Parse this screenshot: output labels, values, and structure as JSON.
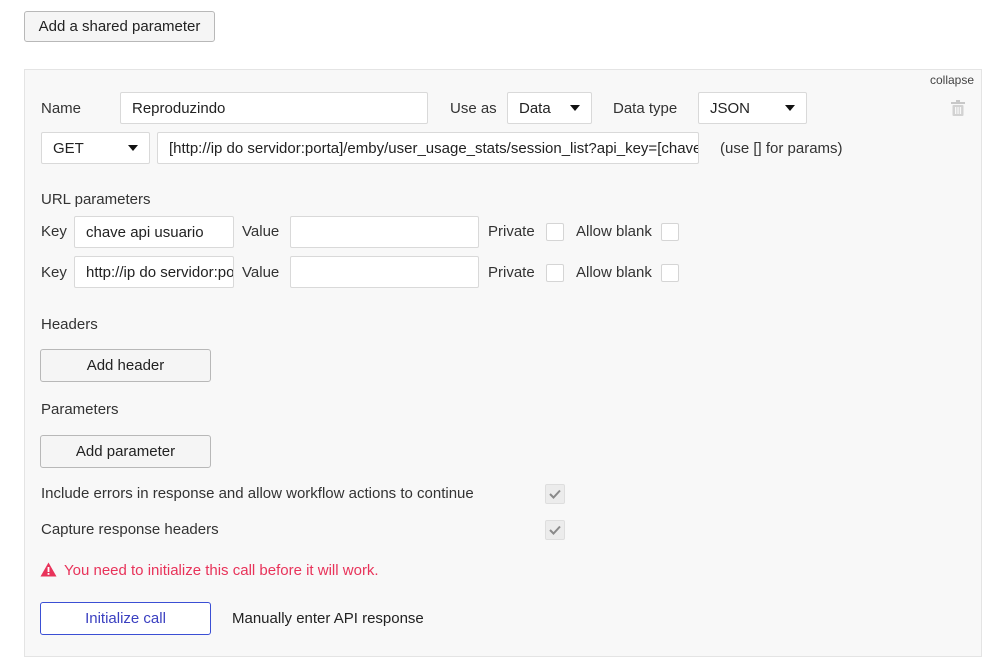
{
  "top": {
    "add_shared_label": "Add a shared parameter"
  },
  "panel": {
    "collapse_label": "collapse",
    "name_label": "Name",
    "name_value": "Reproduzindo",
    "use_as_label": "Use as",
    "use_as_value": "Data",
    "data_type_label": "Data type",
    "data_type_value": "JSON",
    "method_value": "GET",
    "url_value": "[http://ip do servidor:porta]/emby/user_usage_stats/session_list?api_key=[chave api usuario]",
    "url_hint": "(use [] for params)",
    "url_params_title": "URL parameters",
    "url_params": [
      {
        "key_label": "Key",
        "key_value": "chave api usuario",
        "value_label": "Value",
        "value_value": "",
        "private_label": "Private",
        "allow_blank_label": "Allow blank"
      },
      {
        "key_label": "Key",
        "key_value": "http://ip do servidor:porta",
        "value_label": "Value",
        "value_value": "",
        "private_label": "Private",
        "allow_blank_label": "Allow blank"
      }
    ],
    "headers_title": "Headers",
    "add_header_label": "Add header",
    "parameters_title": "Parameters",
    "add_parameter_label": "Add parameter",
    "include_errors_label": "Include errors in response and allow workflow actions to continue",
    "include_errors_checked": true,
    "capture_headers_label": "Capture response headers",
    "capture_headers_checked": true,
    "warning_text": "You need to initialize this call before it will work.",
    "warning_color": "#e8335a",
    "initialize_label": "Initialize call",
    "manual_label": "Manually enter API response",
    "accent_color": "#3b4fd4"
  }
}
